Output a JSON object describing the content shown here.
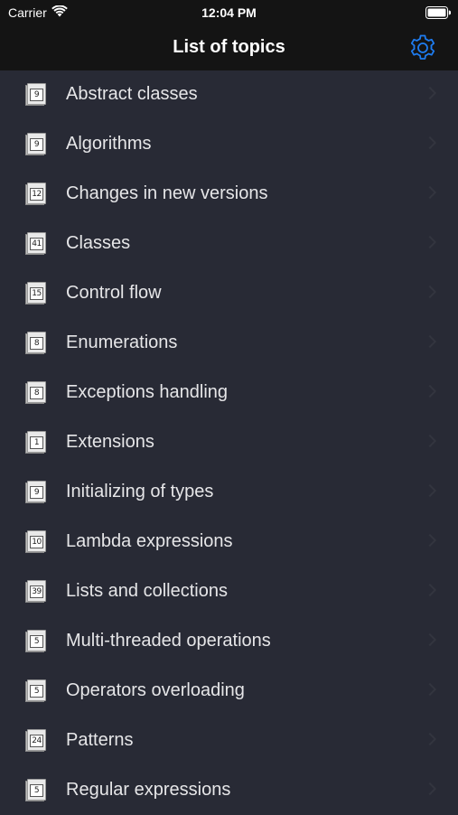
{
  "status_bar": {
    "carrier": "Carrier",
    "time": "12:04 PM"
  },
  "nav": {
    "title": "List of topics",
    "settings_icon": "gear-icon",
    "accent_color": "#1e7cf0"
  },
  "topics": [
    {
      "label": "Abstract classes",
      "count": "9"
    },
    {
      "label": "Algorithms",
      "count": "9"
    },
    {
      "label": "Changes in new versions",
      "count": "12"
    },
    {
      "label": "Classes",
      "count": "41"
    },
    {
      "label": "Control flow",
      "count": "15"
    },
    {
      "label": "Enumerations",
      "count": "8"
    },
    {
      "label": "Exceptions handling",
      "count": "8"
    },
    {
      "label": "Extensions",
      "count": "1"
    },
    {
      "label": "Initializing of types",
      "count": "9"
    },
    {
      "label": "Lambda expressions",
      "count": "10"
    },
    {
      "label": "Lists and collections",
      "count": "39"
    },
    {
      "label": "Multi-threaded operations",
      "count": "5"
    },
    {
      "label": "Operators overloading",
      "count": "5"
    },
    {
      "label": "Patterns",
      "count": "24"
    },
    {
      "label": "Regular expressions",
      "count": "5"
    }
  ]
}
